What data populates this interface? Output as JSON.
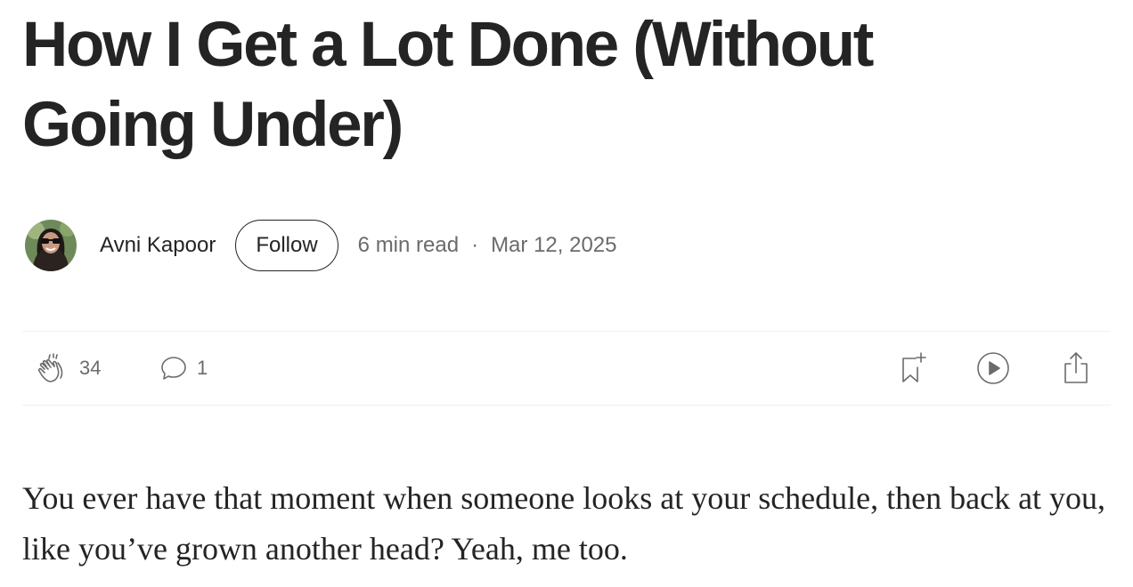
{
  "article": {
    "title": "How I Get a Lot Done (Without Going Under)",
    "author": {
      "name": "Avni Kapoor",
      "avatar": "author-avatar-photo"
    },
    "follow_label": "Follow",
    "read_time": "6 min read",
    "separator": "·",
    "date": "Mar 12, 2025",
    "body_first_paragraph": "You ever have that moment when someone looks at your schedule, then back at you, like you’ve grown another head? Yeah, me too."
  },
  "actions": {
    "clap": {
      "icon": "clap-icon",
      "count": "34"
    },
    "comment": {
      "icon": "comment-icon",
      "count": "1"
    },
    "save": {
      "icon": "bookmark-add-icon"
    },
    "listen": {
      "icon": "play-circle-icon"
    },
    "share": {
      "icon": "share-icon"
    }
  },
  "colors": {
    "text_primary": "#242424",
    "text_secondary": "#6b6b6b",
    "divider": "#f0f0f0",
    "background": "#ffffff"
  }
}
